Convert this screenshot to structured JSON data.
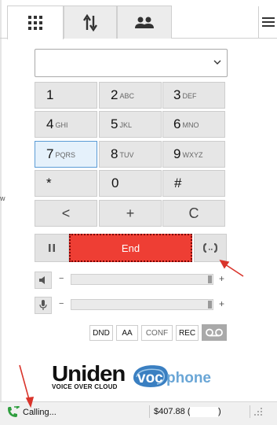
{
  "tabs": [
    {
      "name": "dialpad-icon",
      "active": true
    },
    {
      "name": "transfer-arrows-icon",
      "active": false
    },
    {
      "name": "contacts-icon",
      "active": false
    }
  ],
  "menu": {
    "icon": "hamburger-menu-icon"
  },
  "number_select": {
    "value": ""
  },
  "keypad": [
    {
      "digit": "1",
      "letters": ""
    },
    {
      "digit": "2",
      "letters": "ABC"
    },
    {
      "digit": "3",
      "letters": "DEF"
    },
    {
      "digit": "4",
      "letters": "GHI"
    },
    {
      "digit": "5",
      "letters": "JKL"
    },
    {
      "digit": "6",
      "letters": "MNO"
    },
    {
      "digit": "7",
      "letters": "PQRS"
    },
    {
      "digit": "8",
      "letters": "TUV"
    },
    {
      "digit": "9",
      "letters": "WXYZ"
    },
    {
      "digit": "*",
      "letters": ""
    },
    {
      "digit": "0",
      "letters": ""
    },
    {
      "digit": "#",
      "letters": ""
    },
    {
      "digit": "<",
      "letters": ""
    },
    {
      "digit": "+",
      "letters": ""
    },
    {
      "digit": "C",
      "letters": ""
    }
  ],
  "call": {
    "end_label": "End",
    "end_color": "#ee3e34"
  },
  "volume": {
    "speaker": {
      "minus": "−",
      "plus": "+",
      "level": 1.0
    },
    "mic": {
      "minus": "−",
      "plus": "+",
      "level": 1.0
    }
  },
  "features": {
    "dnd": "DND",
    "aa": "AA",
    "conf": "CONF",
    "rec": "REC"
  },
  "branding": {
    "uniden": "Uniden",
    "uniden_tagline": "VOICE OVER CLOUD",
    "voc": "voc",
    "phone": "phone"
  },
  "status": {
    "text": "Calling...",
    "balance": "$407.88 (",
    "balance_close": ")"
  },
  "stray_text": "w",
  "colors": {
    "accent_blue": "#5b9bd5",
    "end_red": "#ee3e34",
    "annotation_red": "#d9342b"
  }
}
